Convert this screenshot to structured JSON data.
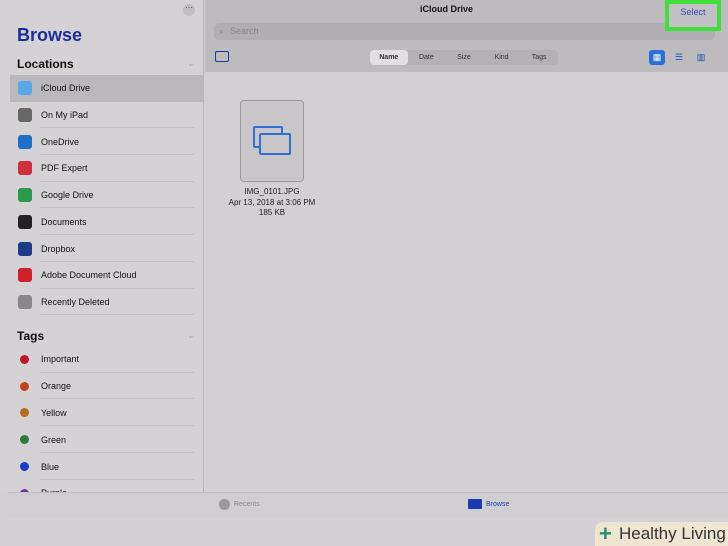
{
  "sidebar": {
    "title": "Browse",
    "more": "···",
    "locations_label": "Locations",
    "tags_label": "Tags",
    "locations": [
      {
        "label": "iCloud Drive",
        "icon": "icloud-icon",
        "color": "#5aa8e6",
        "selected": true
      },
      {
        "label": "On My iPad",
        "icon": "ipad-icon",
        "color": "#666"
      },
      {
        "label": "OneDrive",
        "icon": "onedrive-icon",
        "color": "#1e6fc8"
      },
      {
        "label": "PDF Expert",
        "icon": "pdf-expert-icon",
        "color": "#d0303a"
      },
      {
        "label": "Google Drive",
        "icon": "google-drive-icon",
        "color": "#2b9a4a"
      },
      {
        "label": "Documents",
        "icon": "documents-icon",
        "color": "#222"
      },
      {
        "label": "Dropbox",
        "icon": "dropbox-icon",
        "color": "#1b3a8a"
      },
      {
        "label": "Adobe Document Cloud",
        "icon": "adobe-icon",
        "color": "#d0202a"
      },
      {
        "label": "Recently Deleted",
        "icon": "trash-icon",
        "color": "#888"
      }
    ],
    "tags": [
      {
        "label": "Important",
        "color": "#c0152a"
      },
      {
        "label": "Orange",
        "color": "#c0441a"
      },
      {
        "label": "Yellow",
        "color": "#b86a1a"
      },
      {
        "label": "Green",
        "color": "#2a7a40"
      },
      {
        "label": "Blue",
        "color": "#1a3ac8"
      },
      {
        "label": "Purple",
        "color": "#6a3a9a"
      }
    ]
  },
  "header": {
    "title": "iCloud Drive",
    "select": "Select",
    "search_placeholder": "Search",
    "sort": [
      "Name",
      "Date",
      "Size",
      "Kind",
      "Tags"
    ],
    "active_sort": "Name",
    "active_view": "grid"
  },
  "file": {
    "name": "IMG_0101.JPG",
    "date": "Apr 13, 2018 at 3:06 PM",
    "size": "185 KB"
  },
  "tabbar": {
    "recents": "Recents",
    "browse": "Browse"
  },
  "watermark": "Healthy Living",
  "colors": {
    "accent": "#1a3a9a",
    "highlight": "#3fe03c"
  }
}
